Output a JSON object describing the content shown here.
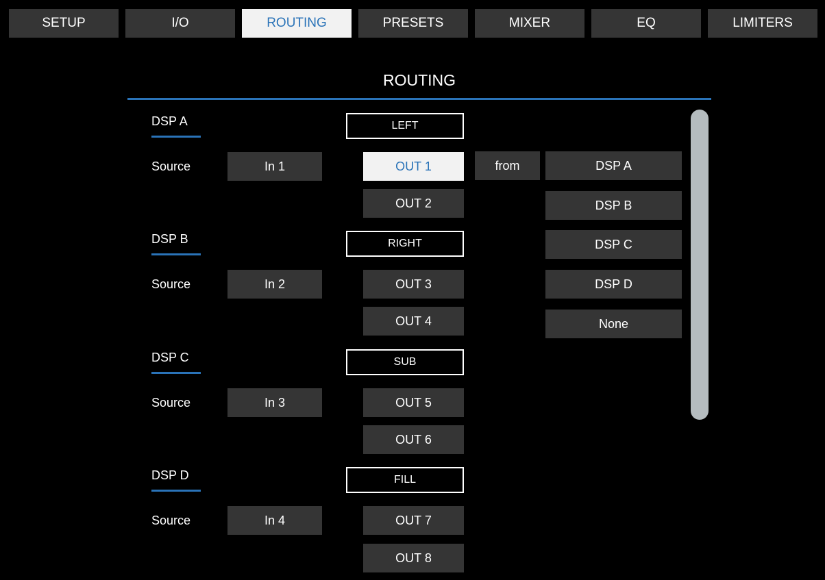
{
  "tabs": [
    {
      "label": "SETUP"
    },
    {
      "label": "I/O"
    },
    {
      "label": "ROUTING"
    },
    {
      "label": "PRESETS"
    },
    {
      "label": "MIXER"
    },
    {
      "label": "EQ"
    },
    {
      "label": "LIMITERS"
    }
  ],
  "active_tab": "ROUTING",
  "page_title": "ROUTING",
  "dsp": [
    {
      "label": "DSP A",
      "source_label": "Source",
      "source_value": "In 1"
    },
    {
      "label": "DSP B",
      "source_label": "Source",
      "source_value": "In 2"
    },
    {
      "label": "DSP C",
      "source_label": "Source",
      "source_value": "In 3"
    },
    {
      "label": "DSP D",
      "source_label": "Source",
      "source_value": "In 4"
    }
  ],
  "groups": [
    {
      "label": "LEFT",
      "outputs": [
        "OUT 1",
        "OUT 2"
      ]
    },
    {
      "label": "RIGHT",
      "outputs": [
        "OUT 3",
        "OUT 4"
      ]
    },
    {
      "label": "SUB",
      "outputs": [
        "OUT 5",
        "OUT 6"
      ]
    },
    {
      "label": "FILL",
      "outputs": [
        "OUT 7",
        "OUT 8"
      ]
    }
  ],
  "selected_output": "OUT 1",
  "from_label": "from",
  "from_options": [
    "DSP A",
    "DSP B",
    "DSP C",
    "DSP D",
    "None"
  ],
  "colors": {
    "accent": "#2a73b8",
    "button_bg": "#353535",
    "selected_bg": "#f2f2f2",
    "scrollbar": "#b5bcbf"
  }
}
